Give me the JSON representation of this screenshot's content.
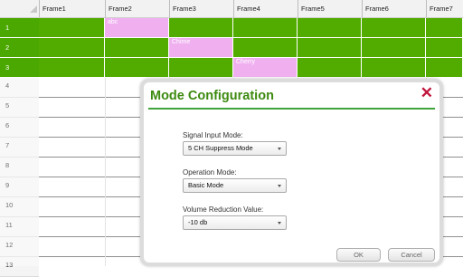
{
  "columns": [
    "Frame1",
    "Frame2",
    "Frame3",
    "Frame4",
    "Frame5",
    "Frame6",
    "Frame7"
  ],
  "rows": [
    {
      "label": "1",
      "cells": [
        "",
        "abc",
        "",
        "",
        "",
        "",
        ""
      ]
    },
    {
      "label": "2",
      "cells": [
        "",
        "",
        "Chime",
        "",
        "",
        "",
        ""
      ]
    },
    {
      "label": "3",
      "cells": [
        "",
        "",
        "",
        "Cherry",
        "",
        "",
        ""
      ]
    },
    {
      "label": "4"
    },
    {
      "label": "5"
    },
    {
      "label": "6"
    },
    {
      "label": "7"
    },
    {
      "label": "8"
    },
    {
      "label": "9"
    },
    {
      "label": "10"
    },
    {
      "label": "11"
    },
    {
      "label": "12"
    },
    {
      "label": "13"
    }
  ],
  "colors": {
    "grid_green": "#52ac00",
    "cell_highlight": "#f0b0f0",
    "title_green": "#3d8a10",
    "close_red": "#c0143c"
  },
  "dialog": {
    "title": "Mode Configuration",
    "close_icon": "close-x-icon",
    "fields": [
      {
        "label": "Signal Input Mode:",
        "value": "5 CH Suppress Mode"
      },
      {
        "label": "Operation Mode:",
        "value": "Basic Mode"
      },
      {
        "label": "Volume Reduction Value:",
        "value": "-10 db"
      }
    ],
    "ok_label": "OK",
    "cancel_label": "Cancel"
  }
}
